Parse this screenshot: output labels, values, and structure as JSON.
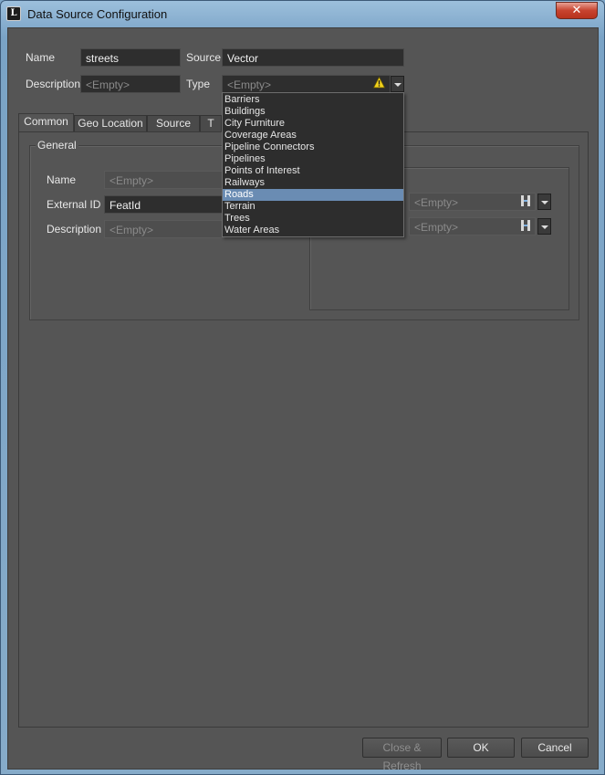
{
  "window": {
    "title": "Data Source Configuration",
    "close_label": "✕",
    "app_icon_letter": "L"
  },
  "top_form": {
    "name_label": "Name",
    "name_value": "streets",
    "source_label": "Source",
    "source_value": "Vector",
    "description_label": "Description",
    "description_placeholder": "<Empty>",
    "type_label": "Type",
    "type_value": "<Empty>"
  },
  "tabs": [
    {
      "label": "Common",
      "active": true
    },
    {
      "label": "Geo Location",
      "active": false
    },
    {
      "label": "Source",
      "active": false
    },
    {
      "label": "T",
      "active": false
    }
  ],
  "general_group": {
    "title": "General",
    "name_label": "Name",
    "name_value": "<Empty>",
    "external_id_label": "External ID",
    "external_id_value": "FeatId",
    "description_label": "Description",
    "description_value": "<Empty>"
  },
  "right_group": {
    "field1_value": "<Empty>",
    "field2_value": "<Empty>"
  },
  "type_dropdown": {
    "options": [
      "Barriers",
      "Buildings",
      "City Furniture",
      "Coverage Areas",
      "Pipeline Connectors",
      "Pipelines",
      "Points of Interest",
      "Railways",
      "Roads",
      "Terrain",
      "Trees",
      "Water Areas"
    ],
    "highlighted": "Roads"
  },
  "footer": {
    "close_refresh_label": "Close & Refresh",
    "ok_label": "OK",
    "cancel_label": "Cancel"
  },
  "colors": {
    "panel_background": "#555555",
    "field_background": "#2e2e2e",
    "selection": "#6a8cb3",
    "warning": "#f2d21b",
    "title_bar": "#9cbfdc",
    "close_button": "#c7432f"
  },
  "icons": {
    "type_warning": "warning-triangle-icon",
    "id_picker": "id-picker-icon",
    "dropdown": "chevron-down-icon"
  }
}
